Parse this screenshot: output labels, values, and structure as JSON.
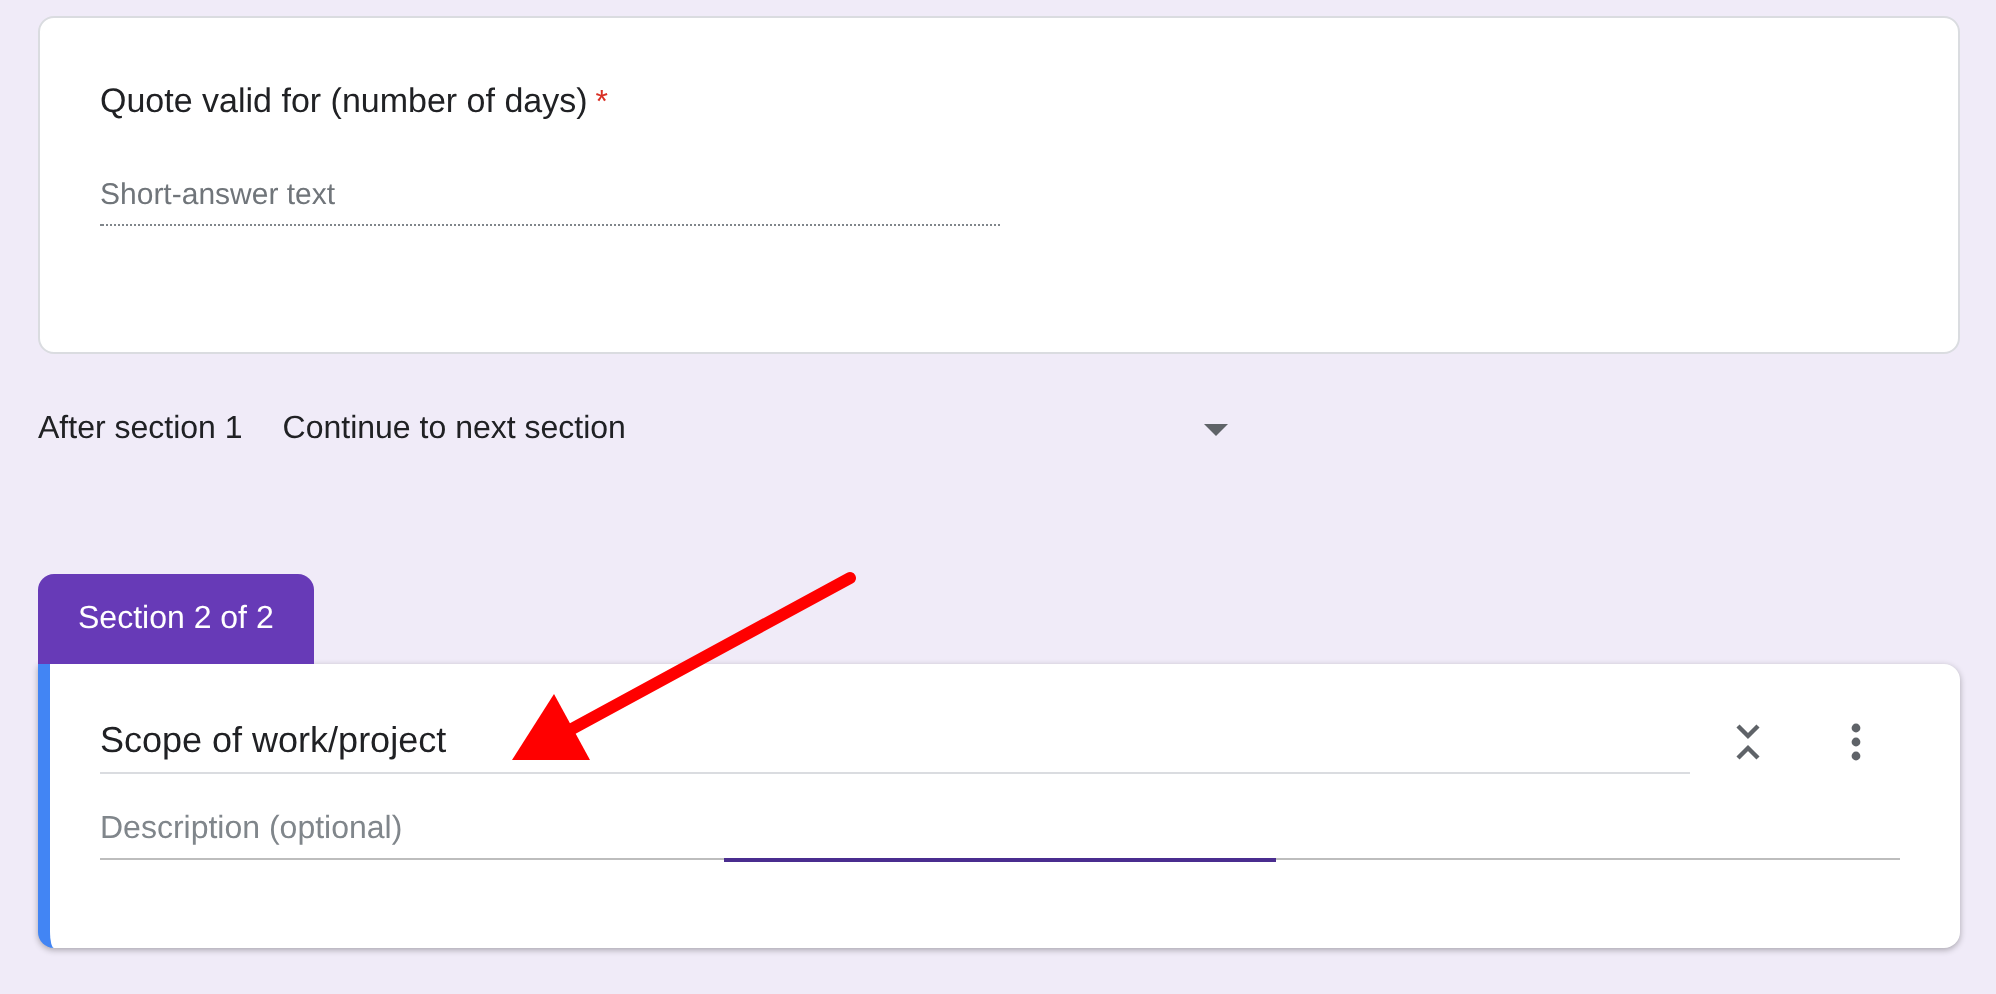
{
  "question": {
    "title": "Quote valid for (number of days)",
    "required": true,
    "required_mark": "*",
    "placeholder": "Short-answer text"
  },
  "after_section": {
    "label": "After section 1",
    "value": "Continue to next section"
  },
  "section": {
    "tab": "Section 2 of 2",
    "title": "Scope of work/project",
    "description_placeholder": "Description (optional)",
    "description_focused": true
  }
}
